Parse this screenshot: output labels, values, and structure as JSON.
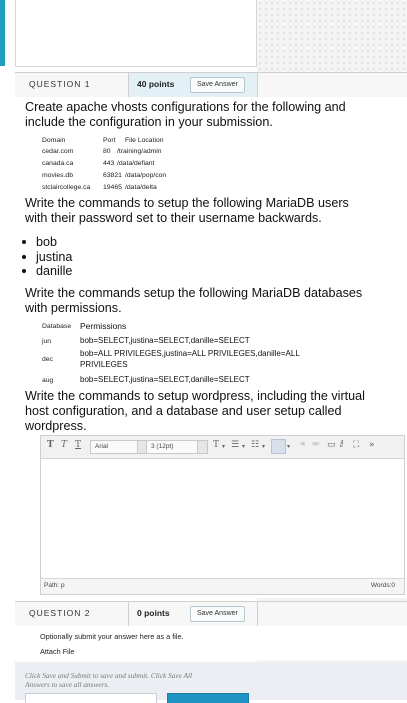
{
  "question1": {
    "title": "QUESTION 1",
    "points": "40 points",
    "save_label": "Save Answer",
    "intro": [
      "Create apache vhosts configurations for the following and",
      "include the configuration in your submission."
    ],
    "vhosts_table": {
      "headers": [
        "Domain",
        "Port",
        "File Location"
      ],
      "rows": [
        [
          "cedar.com",
          "80",
          "/training/admin"
        ],
        [
          "canada.ca",
          "443",
          "/data/defiant"
        ],
        [
          "movies.db",
          "63821",
          "/data/pop/con"
        ],
        [
          "stclaircollege.ca",
          "19465",
          "/data/delta"
        ]
      ]
    },
    "users_instruction": [
      "Write the commands to setup the following MariaDB users",
      "with their password set to their username backwards."
    ],
    "users": [
      "bob",
      "justina",
      "danille"
    ],
    "db_instruction": [
      "Write the commands setup the following MariaDB databases",
      "with permissions."
    ],
    "db_table": {
      "header_db": "Database",
      "header_perm": "Permissions",
      "rows": [
        {
          "db": "jun",
          "perm": [
            "bob=SELECT,justina=SELECT,danille=SELECT"
          ]
        },
        {
          "db": "dec",
          "perm": [
            "bob=ALL PRIVILEGES,justina=ALL PRIVILEGES,danille=ALL",
            "PRIVILEGES"
          ]
        },
        {
          "db": "aug",
          "perm": [
            "bob=SELECT,justina=SELECT,danille=SELECT"
          ]
        }
      ]
    },
    "wp_instruction": [
      "Write the commands to setup wordpress, including the virtual",
      "host configuration, and a database and user setup called",
      "wordpress."
    ],
    "editor": {
      "font_family": "Arial",
      "font_size": "3 (12pt)",
      "path_label": "Path: p",
      "words_label": "Words:0"
    }
  },
  "question2": {
    "title": "QUESTION 2",
    "points": "0 points",
    "save_label": "Save Answer",
    "text": "Optionally submit your answer here as a file.",
    "attach_label": "Attach File"
  },
  "footer": {
    "note": [
      "Click Save and Submit to save and submit. Click Save All",
      "Answers to save all answers."
    ]
  },
  "colors": {
    "accent": "#1f9fbd",
    "points_bg": "#e3f1f6",
    "submit_blue": "#1f93c4"
  }
}
